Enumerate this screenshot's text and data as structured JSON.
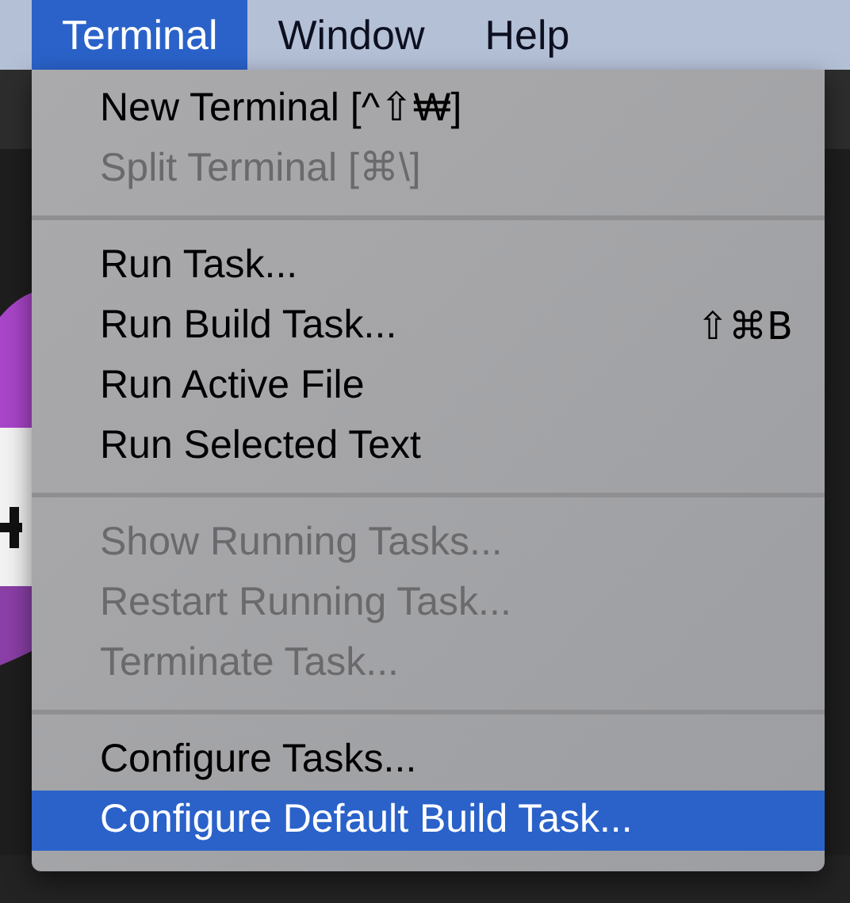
{
  "menu_bar": [
    {
      "label": "Terminal",
      "selected": true
    },
    {
      "label": "Window",
      "selected": false
    },
    {
      "label": "Help",
      "selected": false
    }
  ],
  "menu": {
    "sections": [
      [
        {
          "label": "New Terminal [^⇧₩]",
          "disabled": false,
          "selected": false
        },
        {
          "label": "Split Terminal [⌘\\]",
          "disabled": true,
          "selected": false
        }
      ],
      [
        {
          "label": "Run Task...",
          "disabled": false,
          "selected": false
        },
        {
          "label": "Run Build Task...",
          "shortcut": "⇧⌘B",
          "disabled": false,
          "selected": false
        },
        {
          "label": "Run Active File",
          "disabled": false,
          "selected": false
        },
        {
          "label": "Run Selected Text",
          "disabled": false,
          "selected": false
        }
      ],
      [
        {
          "label": "Show Running Tasks...",
          "disabled": true,
          "selected": false
        },
        {
          "label": "Restart Running Task...",
          "disabled": true,
          "selected": false
        },
        {
          "label": "Terminate Task...",
          "disabled": true,
          "selected": false
        }
      ],
      [
        {
          "label": "Configure Tasks...",
          "disabled": false,
          "selected": false
        },
        {
          "label": "Configure Default Build Task...",
          "disabled": false,
          "selected": true
        }
      ]
    ]
  }
}
